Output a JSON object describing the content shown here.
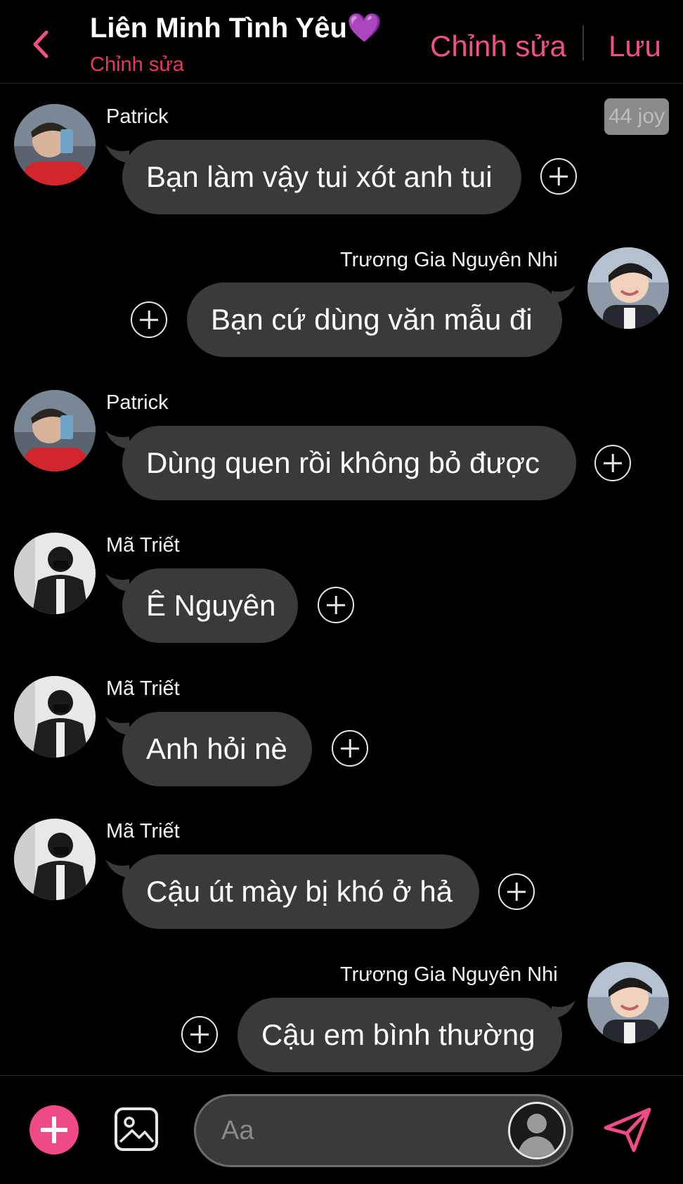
{
  "header": {
    "title": "Liên Minh Tình Yêu💜",
    "subtitle": "Chỉnh sửa",
    "edit_label": "Chỉnh sửa",
    "save_label": "Lưu"
  },
  "badge": "44 joy",
  "messages": [
    {
      "sender": "Patrick",
      "text": "Bạn làm vậy tui xót anh tui",
      "side": "left",
      "avatar": "avatar-patrick"
    },
    {
      "sender": "Trương Gia Nguyên Nhi",
      "text": "Bạn cứ dùng văn mẫu đi",
      "side": "right",
      "avatar": "avatar-nguyen-nhi"
    },
    {
      "sender": "Patrick",
      "text": "Dùng quen rồi không bỏ được",
      "side": "left",
      "avatar": "avatar-patrick"
    },
    {
      "sender": "Mã Triết",
      "text": "Ê Nguyên",
      "side": "left",
      "avatar": "avatar-ma-triet"
    },
    {
      "sender": "Mã Triết",
      "text": "Anh hỏi nè",
      "side": "left",
      "avatar": "avatar-ma-triet"
    },
    {
      "sender": "Mã Triết",
      "text": "Cậu út mày bị khó ở hả",
      "side": "left",
      "avatar": "avatar-ma-triet"
    },
    {
      "sender": "Trương Gia Nguyên Nhi",
      "text": "Cậu em bình thường",
      "side": "right",
      "avatar": "avatar-nguyen-nhi"
    }
  ],
  "composer": {
    "placeholder": "Aa"
  },
  "colors": {
    "accent": "#ef4b87",
    "subtitle": "#e8385f",
    "bubble": "#3a3a3c",
    "background": "#000000"
  },
  "icons": [
    "chevron-left-icon",
    "plus-circle-icon",
    "image-icon",
    "user-silhouette-icon",
    "send-icon"
  ]
}
